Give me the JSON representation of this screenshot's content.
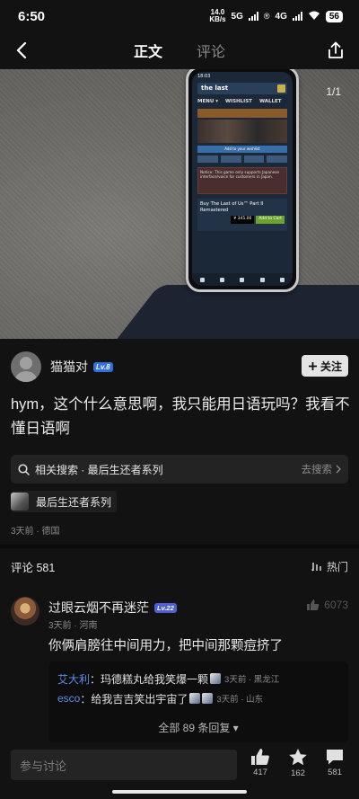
{
  "status_bar": {
    "time": "6:50",
    "net_speed_value": "14.0",
    "net_speed_unit": "KB/s",
    "sig_a": "5G",
    "sig_b": "4G",
    "battery": "56"
  },
  "nav": {
    "tabs": [
      "正文",
      "评论"
    ],
    "active_tab": "正文"
  },
  "photo": {
    "page_indicator": "1/1",
    "phone_screen": {
      "time": "18:03",
      "search_text": "the last",
      "menu_items": [
        "MENU ▾",
        "WISHLIST",
        "WALLET"
      ],
      "wishlist_button": "Add to your wishlist",
      "notice": "Notice: This game only supports Japanese interface/voice for customers in Japan.",
      "buy_title": "Buy The Last of Us™ Part II Remastered",
      "price": "¥ 345.00",
      "cart": "Add to Cart"
    }
  },
  "author": {
    "name": "猫猫对",
    "level": "Lv.8",
    "follow_label": "关注"
  },
  "post": {
    "text": "hym，这个什么意思啊，我只能用日语玩吗？我看不懂日语啊"
  },
  "related": {
    "label": "相关搜索 · 最后生还者系列",
    "action": "去搜索"
  },
  "topic": {
    "label": "最后生还者系列"
  },
  "meta": "3天前 · 德国",
  "comments": {
    "title": "评论 581",
    "sort_label": "热门",
    "items": [
      {
        "user": "过眼云烟不再迷茫",
        "level": "Lv.22",
        "likes": "6073",
        "meta": "3天前 · 河南",
        "text": "你俩肩膀往中间用力，把中间那颗痘挤了",
        "replies": [
          {
            "user": "艾大利",
            "text": "玛德糕丸给我笑爆一颗",
            "meta": "3天前 · 黑龙江"
          },
          {
            "user": "esco",
            "text": "给我吉吉笑出宇宙了",
            "meta": "3天前 · 山东"
          }
        ],
        "all_replies": "全部 89 条回复 ▾"
      }
    ]
  },
  "bottom_bar": {
    "input_placeholder": "参与讨论",
    "likes": "417",
    "stars": "162",
    "comments": "581"
  },
  "colors": {
    "background": "#121212",
    "accent_blue": "#5a8dee",
    "level_badge": "#2f6fe0"
  }
}
